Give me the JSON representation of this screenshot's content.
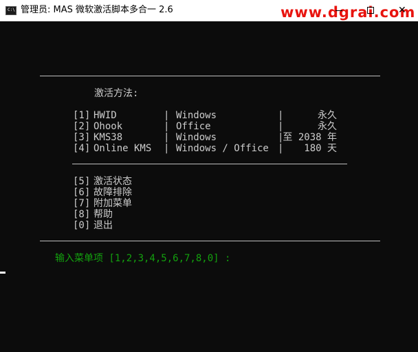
{
  "window": {
    "title": "管理员:  MAS 微软激活脚本多合一 2.6",
    "icon_label": "C:\\",
    "watermark": "www.dgrai.com",
    "controls": {
      "minimize": "minimize-icon",
      "maximize": "maximize-icon",
      "close": "✕"
    }
  },
  "menu": {
    "heading": "激活方法:",
    "activation_items": [
      {
        "num": "[1]",
        "name": "HWID",
        "edition": "Windows",
        "duration": "永久"
      },
      {
        "num": "[2]",
        "name": "Ohook",
        "edition": "Office",
        "duration": "永久"
      },
      {
        "num": "[3]",
        "name": "KMS38",
        "edition": "Windows",
        "duration": "至 2038 年"
      },
      {
        "num": "[4]",
        "name": "Online KMS",
        "edition": "Windows / Office",
        "duration": "180 天"
      }
    ],
    "separator": "|",
    "extra_items": [
      {
        "num": "[5]",
        "name": "激活状态"
      },
      {
        "num": "[6]",
        "name": "故障排除"
      },
      {
        "num": "[7]",
        "name": "附加菜单"
      },
      {
        "num": "[8]",
        "name": "帮助"
      },
      {
        "num": "[0]",
        "name": "退出"
      }
    ],
    "prompt": "输入菜单项 [1,2,3,4,5,6,7,8,0] :"
  },
  "colors": {
    "console_bg": "#0c0c0c",
    "text": "#cccccc",
    "prompt": "#13a10e",
    "watermark": "#e8140f"
  }
}
